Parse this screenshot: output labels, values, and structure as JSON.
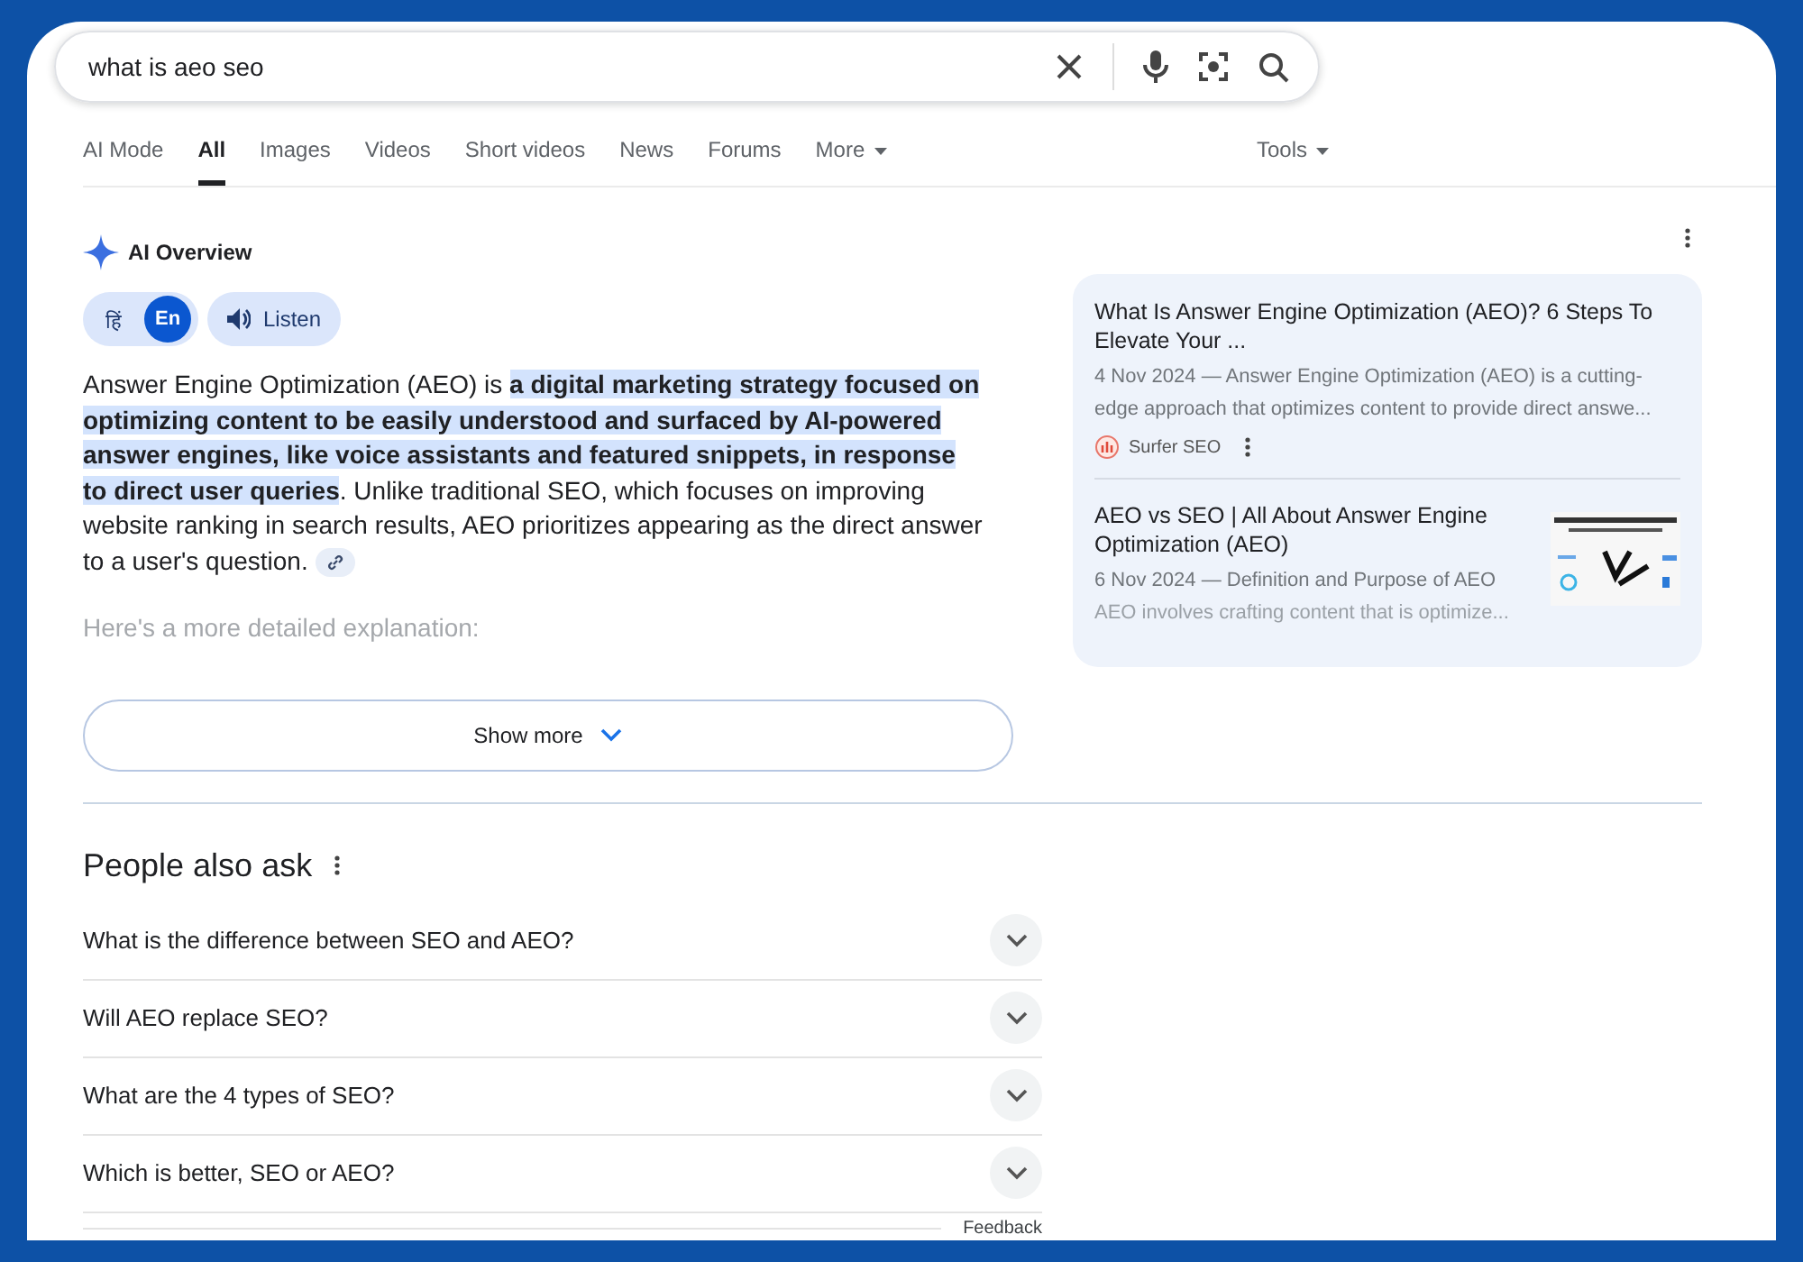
{
  "search": {
    "value": "what is aeo seo"
  },
  "tabs": [
    {
      "label": "AI Mode",
      "selected": false,
      "dropdown": false
    },
    {
      "label": "All",
      "selected": true,
      "dropdown": false
    },
    {
      "label": "Images",
      "selected": false,
      "dropdown": false
    },
    {
      "label": "Videos",
      "selected": false,
      "dropdown": false
    },
    {
      "label": "Short videos",
      "selected": false,
      "dropdown": false
    },
    {
      "label": "News",
      "selected": false,
      "dropdown": false
    },
    {
      "label": "Forums",
      "selected": false,
      "dropdown": false
    },
    {
      "label": "More",
      "selected": false,
      "dropdown": true
    }
  ],
  "tools": {
    "label": "Tools"
  },
  "ai_overview": {
    "title": "AI Overview",
    "languages": [
      {
        "label": "हिं",
        "selected": false
      },
      {
        "label": "En",
        "selected": true
      }
    ],
    "listen": "Listen",
    "paragraph": [
      {
        "text": "Answer Engine Optimization (AEO) is ",
        "highlighted": false
      },
      {
        "text": "a digital marketing strategy focused on optimizing content to be easily understood and surfaced by AI-powered answer engines, like voice assistants and featured snippets, in response to direct user queries",
        "highlighted": true
      },
      {
        "text": ". Unlike traditional SEO, which focuses on improving website ranking in search results, AEO prioritizes appearing as the direct answer to a user's question.",
        "highlighted": false
      }
    ],
    "faded_text": "Here's a more detailed explanation:",
    "show_more": "Show more",
    "sources": [
      {
        "title": "What Is Answer Engine Optimization (AEO)? 6 Steps To Elevate Your ...",
        "snippet": "4 Nov 2024 — Answer Engine Optimization (AEO) is a cutting-edge approach that optimizes content to provide direct answe...",
        "site": "Surfer SEO",
        "thumbnail": false
      },
      {
        "title": "AEO vs SEO | All About Answer Engine Optimization (AEO)",
        "snippet": "6 Nov 2024 — Definition and Purpose of AEO",
        "snippet_faded": "AEO involves crafting content that is optimize...",
        "thumbnail": true
      }
    ]
  },
  "people_also_ask": {
    "title": "People also ask",
    "questions": [
      {
        "text": "What is the difference between SEO and AEO?",
        "expanded": false
      },
      {
        "text": "Will AEO replace SEO?",
        "expanded": false
      },
      {
        "text": "What are the 4 types of SEO?",
        "expanded": false
      },
      {
        "text": "Which is better, SEO or AEO?",
        "expanded": false
      }
    ],
    "feedback": "Feedback"
  }
}
